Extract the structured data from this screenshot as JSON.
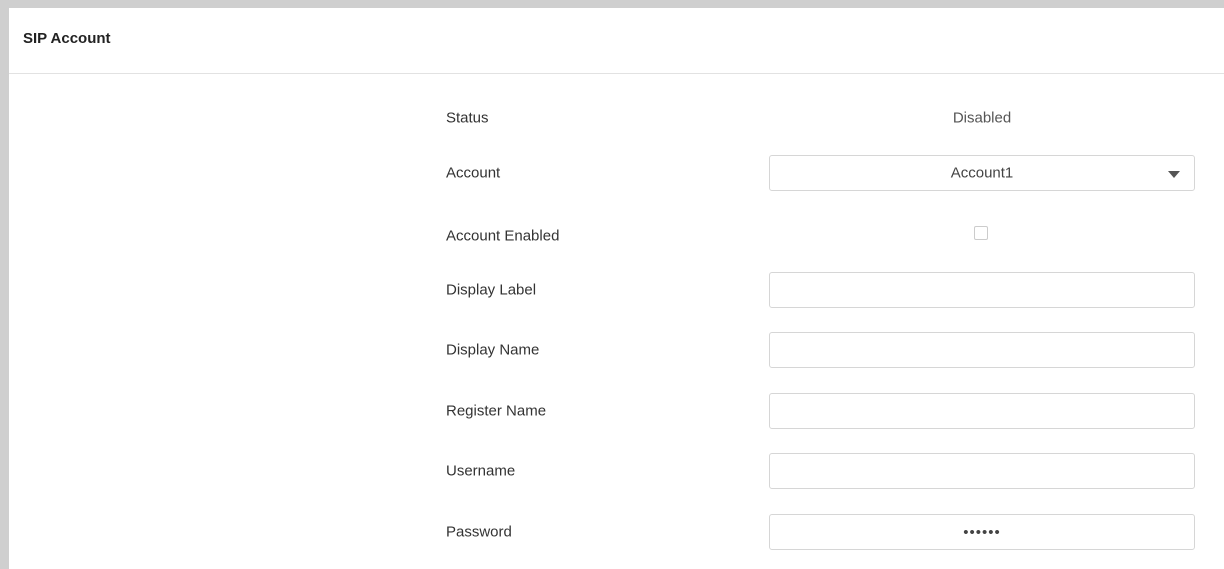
{
  "panel": {
    "title": "SIP Account"
  },
  "fields": {
    "status": {
      "label": "Status",
      "value": "Disabled"
    },
    "account": {
      "label": "Account",
      "selected": "Account1",
      "icon": "chevron-down-icon"
    },
    "account_enabled": {
      "label": "Account Enabled",
      "checked": false
    },
    "display_label": {
      "label": "Display Label",
      "value": ""
    },
    "display_name": {
      "label": "Display Name",
      "value": ""
    },
    "register_name": {
      "label": "Register Name",
      "value": ""
    },
    "username": {
      "label": "Username",
      "value": ""
    },
    "password": {
      "label": "Password",
      "value": "••••••"
    }
  },
  "colors": {
    "frame_border": "#cfcfcf",
    "input_border": "#d6d6d6",
    "text": "#333333"
  }
}
